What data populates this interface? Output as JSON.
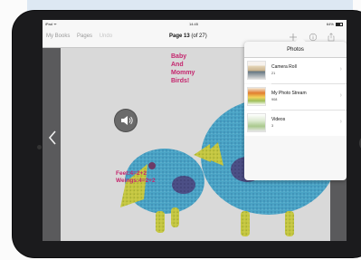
{
  "status_bar": {
    "carrier": "iPad ᯤ",
    "time": "14:45",
    "battery": "64%"
  },
  "nav": {
    "my_books": "My Books",
    "pages": "Pages",
    "undo": "Undo",
    "title_bold": "Page 13",
    "title_rest": " (of 27)"
  },
  "page": {
    "title_lines": [
      "Baby",
      "And",
      "Mommy",
      "Birds!"
    ],
    "math_lines": [
      "Feet:4=2+2",
      "Weings:4=2+2"
    ]
  },
  "popover": {
    "title": "Photos",
    "albums": [
      {
        "name": "Camera Roll",
        "count": "21"
      },
      {
        "name": "My Photo Stream",
        "count": "908"
      },
      {
        "name": "Videos",
        "count": "3"
      }
    ]
  },
  "icons": {
    "add": "add-icon",
    "info": "info-icon",
    "share": "share-icon",
    "sound": "speaker-icon",
    "prev": "chevron-left-icon",
    "chevron": "chevron-right-icon"
  },
  "colors": {
    "text_pink": "#c4256d",
    "bird_blue": "#4aa3c5",
    "bird_green": "#c4c640"
  }
}
